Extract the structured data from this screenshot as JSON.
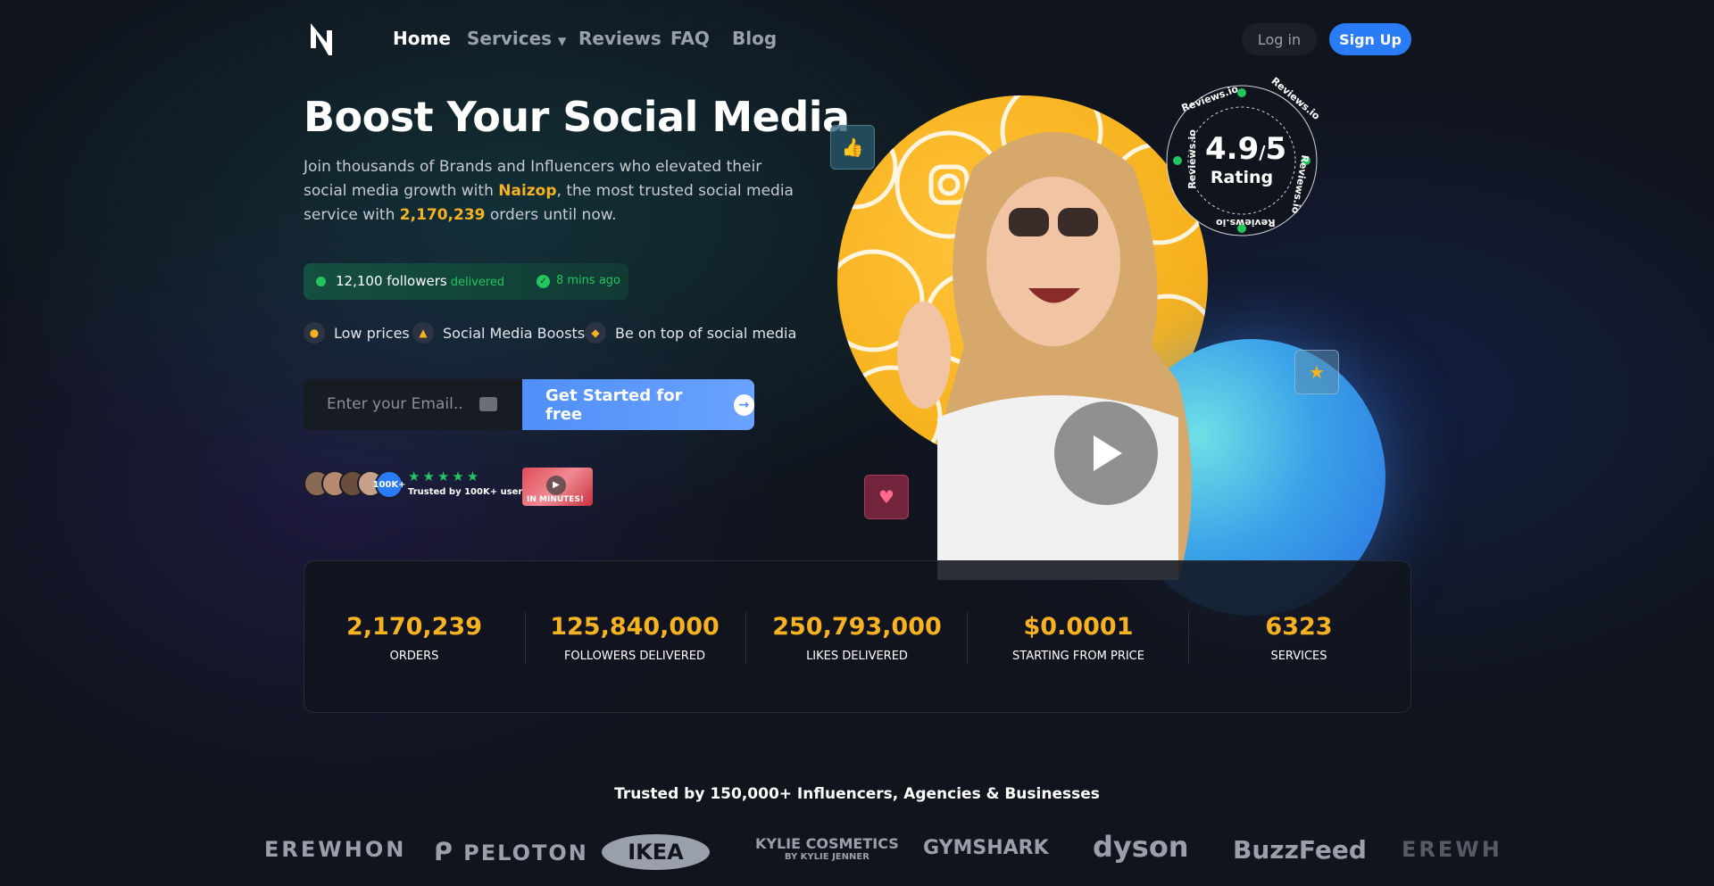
{
  "nav": {
    "links": [
      {
        "label": "Home",
        "active": true
      },
      {
        "label": "Services"
      },
      {
        "label": "Reviews"
      },
      {
        "label": "FAQ"
      },
      {
        "label": "Blog"
      }
    ],
    "login": "Log in",
    "signup": "Sign Up"
  },
  "hero": {
    "title": "Boost Your Social Media",
    "desc_1": "Join thousands of Brands and Influencers who elevated their social media growth with ",
    "brand": "Naizop",
    "desc_2": ", the most trusted social media service with ",
    "order_count": "2,170,239",
    "desc_3": " orders until now."
  },
  "delivered": {
    "count_text": "12,100 followers",
    "status": "delivered",
    "ago": "8 mins ago"
  },
  "features": [
    "Low prices",
    "Social Media Boosts",
    "Be on top of social media"
  ],
  "signup_form": {
    "email_placeholder": "Enter your Email..",
    "cta": "Get Started for free"
  },
  "social_proof": {
    "badge": "100K+",
    "stars": "★★★★★",
    "text": "Trusted by 100K+ users",
    "thumb_text": "IN MINUTES!"
  },
  "rating": {
    "value": "4.9",
    "max": "5",
    "label": "Rating",
    "ring_text": "Reviews.io"
  },
  "stats": [
    {
      "value": "2,170,239",
      "label": "ORDERS"
    },
    {
      "value": "125,840,000",
      "label": "FOLLOWERS DELIVERED"
    },
    {
      "value": "250,793,000",
      "label": "LIKES DELIVERED"
    },
    {
      "value": "$0.0001",
      "label": "STARTING FROM PRICE"
    },
    {
      "value": "6323",
      "label": "SERVICES"
    }
  ],
  "trusted": {
    "title": "Trusted by 150,000+ Influencers, Agencies & Businesses",
    "brands": [
      "EREWHON",
      "PELOTON",
      "IKEA",
      "KYLIE COSMETICS",
      "BY KYLIE JENNER",
      "GYMSHARK",
      "dyson",
      "BuzzFeed",
      "EREWH"
    ]
  },
  "colors": {
    "accent_yellow": "#f6b221",
    "accent_blue": "#2a7bf6",
    "success_green": "#22c55e"
  }
}
